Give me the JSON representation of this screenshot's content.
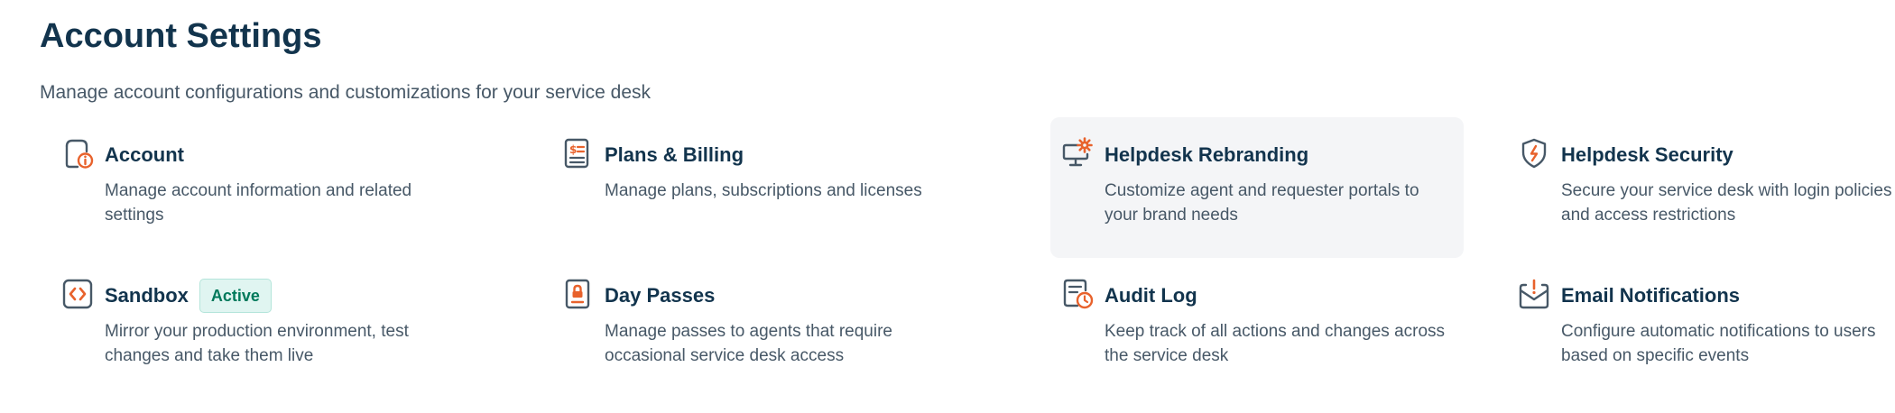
{
  "header": {
    "title": "Account Settings",
    "subtitle": "Manage account configurations and customizations for your service desk"
  },
  "colors": {
    "heading": "#12344d",
    "text": "#475867",
    "accent": "#e8622c",
    "badge_bg": "#e0f5f1",
    "badge_text": "#00795b",
    "highlight_bg": "#f4f5f7"
  },
  "cards": [
    {
      "icon": "account-info-icon",
      "title": "Account",
      "description": "Manage account information and related settings"
    },
    {
      "icon": "billing-invoice-icon",
      "title": "Plans & Billing",
      "description": "Manage plans, subscriptions and licenses"
    },
    {
      "icon": "monitor-gear-icon",
      "title": "Helpdesk Rebranding",
      "description": "Customize agent and requester portals to your brand needs"
    },
    {
      "icon": "shield-icon",
      "title": "Helpdesk Security",
      "description": "Secure your service desk with login policies and access restrictions"
    },
    {
      "icon": "code-brackets-icon",
      "title": "Sandbox",
      "badge": "Active",
      "description": "Mirror your production environment, test changes and take them live"
    },
    {
      "icon": "badge-pass-icon",
      "title": "Day Passes",
      "description": "Manage passes to agents that require occasional service desk access"
    },
    {
      "icon": "log-clock-icon",
      "title": "Audit Log",
      "description": "Keep track of all actions and changes across the service desk"
    },
    {
      "icon": "envelope-alert-icon",
      "title": "Email Notifications",
      "description": "Configure automatic notifications to users based on specific events"
    }
  ]
}
